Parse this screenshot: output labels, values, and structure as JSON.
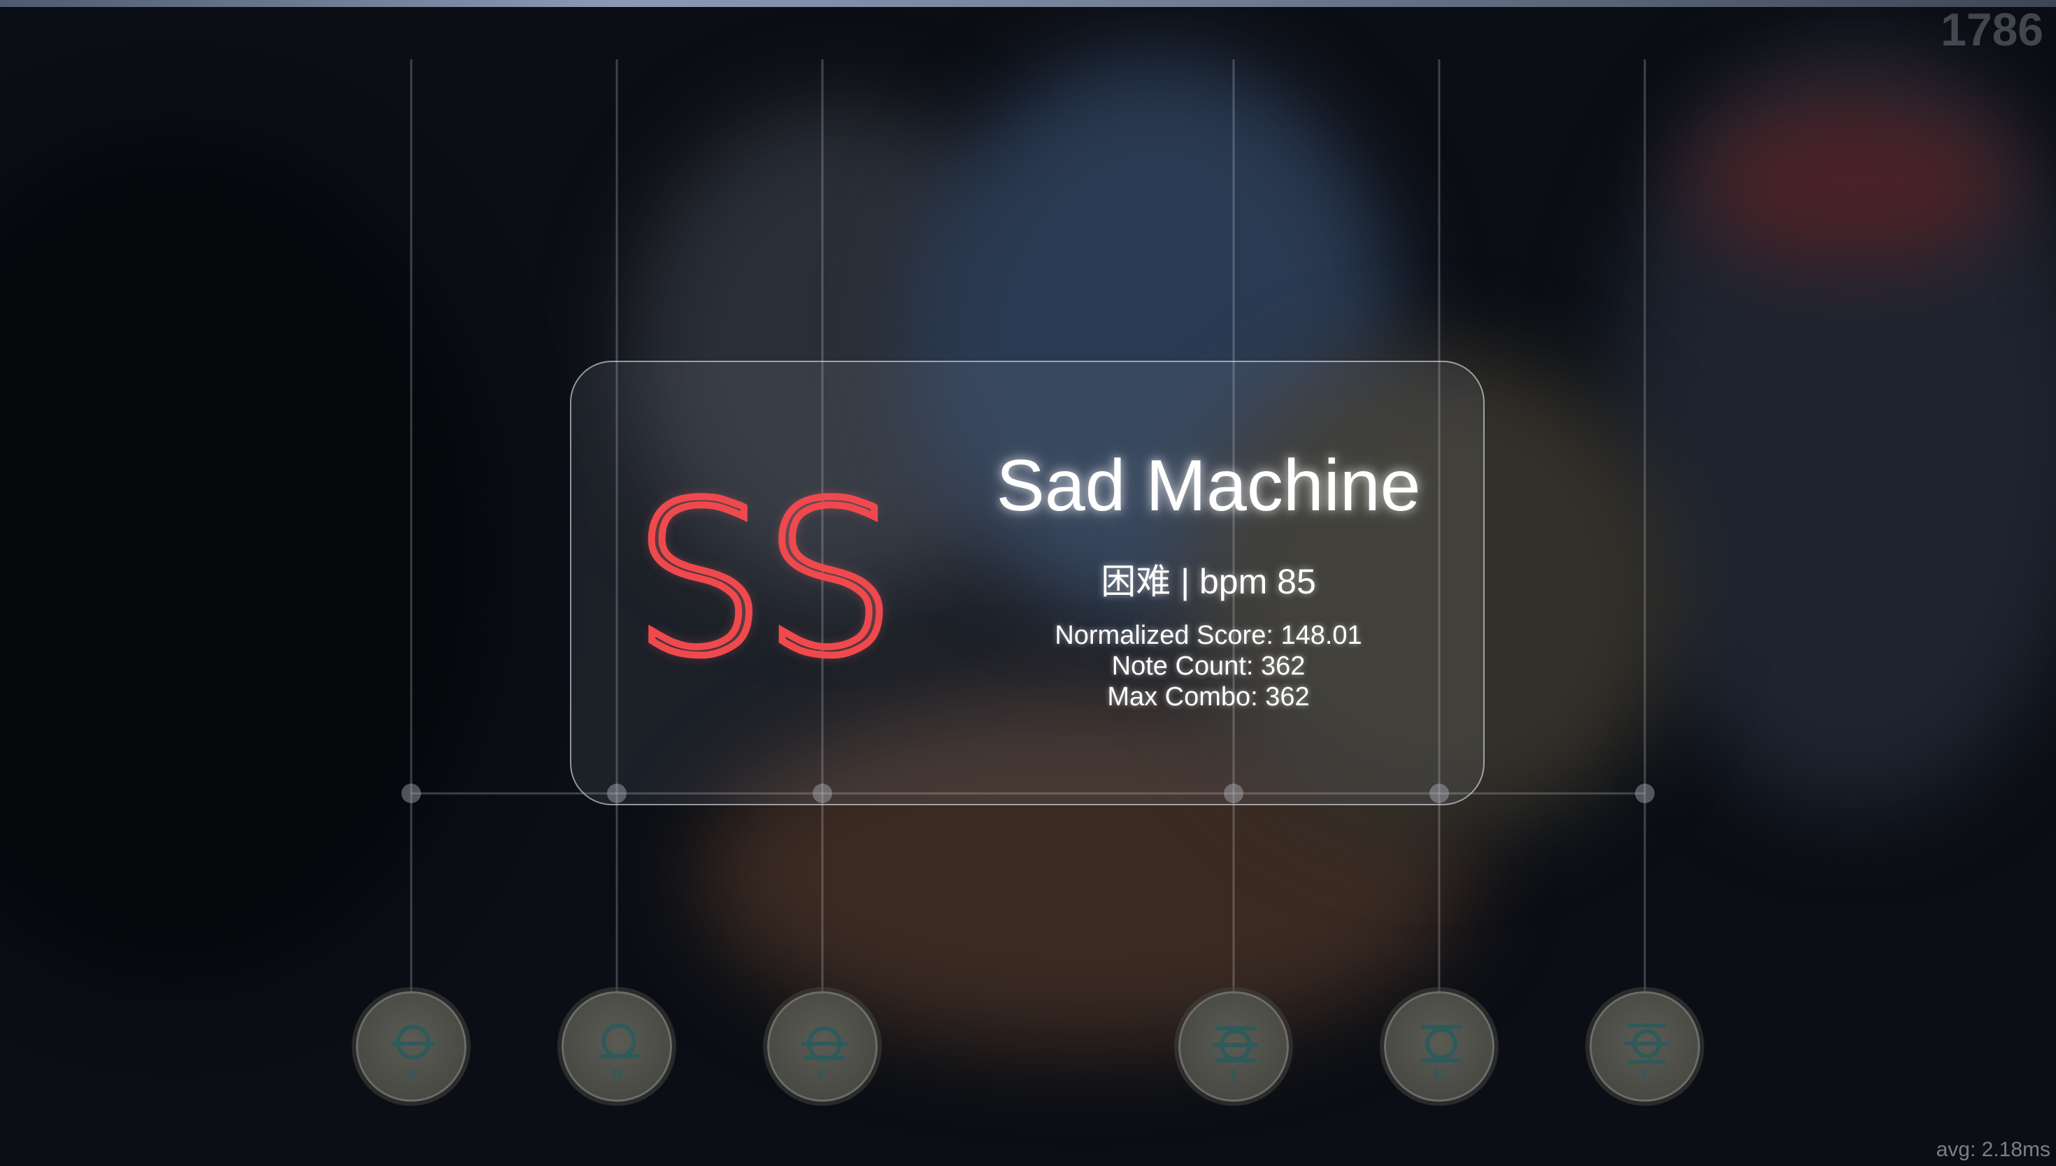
{
  "hud": {
    "frame_counter": "1786",
    "avg_latency": "avg: 2.18ms"
  },
  "result": {
    "rank": "SS",
    "song_title": "Sad Machine",
    "difficulty_line": "困难 | bpm 85",
    "normalized_score": "Normalized Score: 148.01",
    "note_count": "Note Count: 362",
    "max_combo": "Max Combo: 362"
  },
  "keys": [
    {
      "label": "S",
      "icon": "lane-glyph-icon"
    },
    {
      "label": "D",
      "icon": "lane-glyph-icon"
    },
    {
      "label": "F",
      "icon": "lane-glyph-icon"
    },
    {
      "label": "J",
      "icon": "lane-glyph-icon"
    },
    {
      "label": "K",
      "icon": "lane-glyph-icon"
    },
    {
      "label": "L",
      "icon": "lane-glyph-icon"
    }
  ],
  "colors": {
    "rank_stroke": "#f0494d",
    "key_glyph": "#2e5a5a",
    "text": "#ffffff"
  }
}
